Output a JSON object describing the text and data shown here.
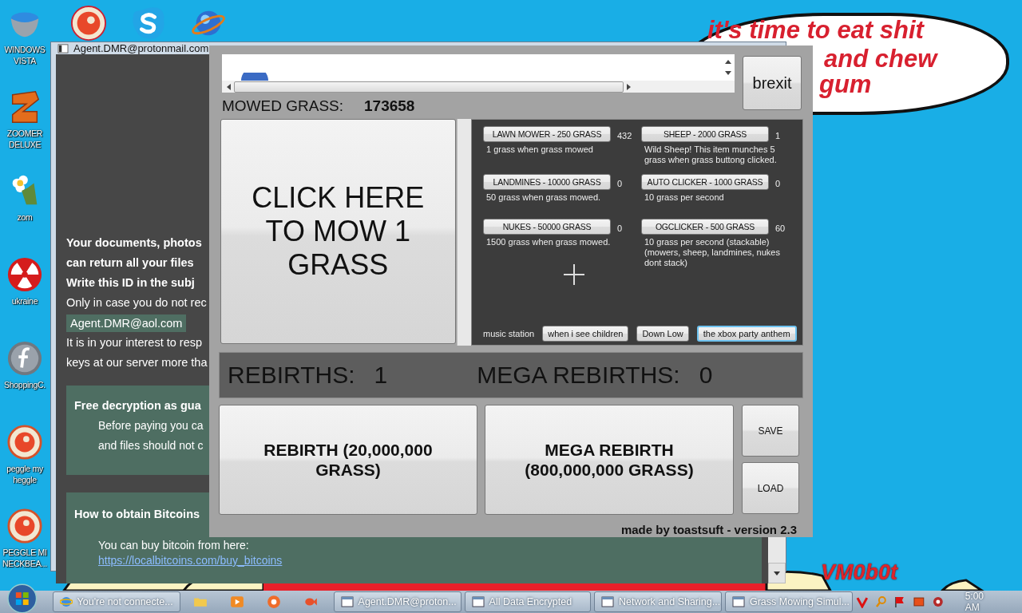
{
  "desktop_icons": [
    {
      "label": "WINDOWS VISTA"
    },
    {
      "label": "ZOOMER DELUXE"
    },
    {
      "label": "zom"
    },
    {
      "label": "ukraine"
    },
    {
      "label": "ShoppingC."
    },
    {
      "label": "peggle my heggle"
    },
    {
      "label": "PEGGLE MI NECKBEA..."
    }
  ],
  "speech_bubble": {
    "lines": [
      "it's time to eat shit",
      "and chew",
      "gum"
    ]
  },
  "wallpaper_text": "VM0b0t",
  "ransom_window": {
    "title": "Agent.DMR@protonmail.com",
    "lines": [
      {
        "kind": "bold",
        "text": "Your documents, photos"
      },
      {
        "kind": "bold",
        "text": "can return all your files"
      },
      {
        "kind": "bold",
        "text": "Write this ID in the subj"
      },
      {
        "kind": "plain",
        "text": "Only in case you do not rec"
      },
      {
        "kind": "badge",
        "text": "Agent.DMR@aol.com"
      },
      {
        "kind": "plain",
        "text": "It is in your interest to resp"
      },
      {
        "kind": "plain",
        "text": "keys at our server more tha"
      }
    ],
    "sections": [
      {
        "heading": "Free decryption as gua",
        "lines": [
          "Before paying you ca",
          "and files should not c"
        ]
      },
      {
        "heading": "How to obtain Bitcoins",
        "lines": [
          "You can buy bitcoin from here:"
        ],
        "link": "https://localbitcoins.com/buy_bitcoins"
      }
    ]
  },
  "game_window": {
    "brexit_button": "brexit",
    "mowed_label": "MOWED GRASS:",
    "mowed_value": "173658",
    "mow_button": "CLICK HERE TO MOW 1 GRASS",
    "shop": [
      {
        "button": "LAWN MOWER - 250 GRASS",
        "count": "432",
        "description": "1 grass when grass mowed"
      },
      {
        "button": "SHEEP - 2000 GRASS",
        "count": "1",
        "description": "Wild Sheep! This item munches 5 grass when grass buttong clicked."
      },
      {
        "button": "LANDMINES - 10000 GRASS",
        "count": "0",
        "description": "50 grass when grass mowed."
      },
      {
        "button": "AUTO CLICKER - 1000 GRASS",
        "count": "0",
        "description": "10 grass per second"
      },
      {
        "button": "NUKES - 50000 GRASS",
        "count": "0",
        "description": "1500 grass when grass mowed."
      },
      {
        "button": "OGCLICKER - 500 GRASS",
        "count": "60",
        "description": "10 grass per second (stackable) (mowers, sheep, landmines, nukes dont stack)"
      }
    ],
    "music": {
      "label": "music station",
      "stations": [
        {
          "label": "when i see children",
          "focused": false
        },
        {
          "label": "Down Low",
          "focused": false
        },
        {
          "label": "the xbox party anthem",
          "focused": true
        }
      ]
    },
    "rebirths": {
      "label": "REBIRTHS:",
      "value": "1"
    },
    "mega_rebirths": {
      "label": "MEGA REBIRTHS:",
      "value": "0"
    },
    "rebirth_button": "REBIRTH (20,000,000 GRASS)",
    "mega_rebirth_button": "MEGA REBIRTH (800,000,000 GRASS)",
    "save_button": "SAVE",
    "load_button": "LOAD",
    "credit": "made by toastsuft - version 2.3"
  },
  "taskbar": {
    "items": [
      {
        "label": "You're not connecte..."
      },
      {
        "label": "Agent.DMR@proton..."
      },
      {
        "label": "All Data Encrypted"
      },
      {
        "label": "Network and Sharing..."
      },
      {
        "label": "Grass Mowing Simul..."
      }
    ],
    "clock": "5:00 AM"
  }
}
